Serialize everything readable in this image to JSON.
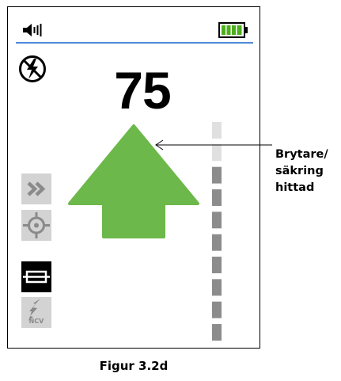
{
  "display": {
    "reading": "75",
    "icons": {
      "speaker": "speaker-volume-icon",
      "battery": "battery-full-icon",
      "no_voltage": "no-voltage-icon",
      "arrow": "arrow-up-icon"
    },
    "side_buttons": [
      {
        "name": "fast-forward-button",
        "icon": "double-chevron-icon",
        "state": "inactive"
      },
      {
        "name": "target-button",
        "icon": "crosshair-icon",
        "state": "inactive"
      },
      {
        "name": "fuse-button",
        "icon": "fuse-icon",
        "state": "active"
      },
      {
        "name": "ncv-button",
        "icon": "ncv-lightning-icon",
        "label": "NCV",
        "state": "inactive"
      }
    ],
    "signal_level": {
      "segments": 10,
      "active_from_bottom": 8
    },
    "colors": {
      "arrow": "#6cb84a",
      "header_line": "#4d8ad9",
      "battery": "#4caf1e",
      "inactive_button": "#d3d3d3",
      "active_button": "#000000",
      "level_on": "#8c8c8c",
      "level_off": "#e0e0e0"
    }
  },
  "callout": {
    "lines": [
      "Brytare/",
      "säkring",
      "hittad"
    ]
  },
  "caption": "Figur 3.2d"
}
